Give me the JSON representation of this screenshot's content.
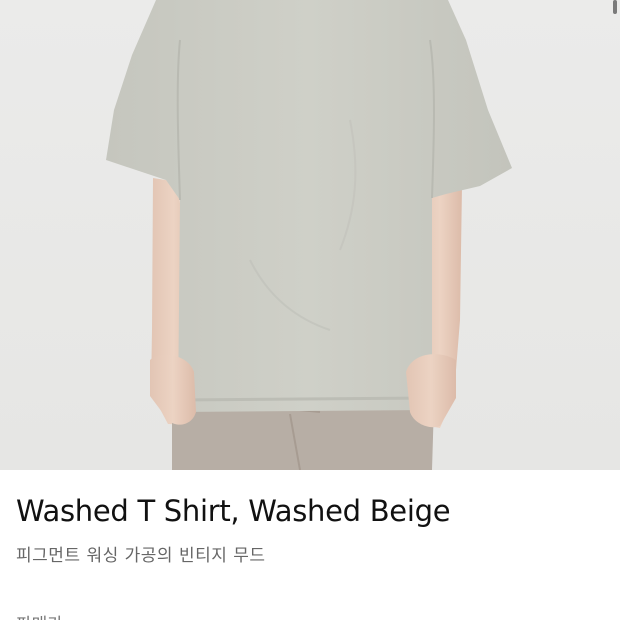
{
  "product": {
    "image_alt": "Washed T Shirt, Washed Beige",
    "title": "Washed T Shirt, Washed Beige",
    "subtitle": "피그먼트 워싱 가공의 빈티지 무드",
    "next_section_label": "판매가"
  },
  "colors": {
    "background": "#ffffff",
    "shirt": "#c9cac2",
    "pants": "#b6aca3",
    "title_text": "#111111",
    "subtitle_text": "#666666"
  }
}
